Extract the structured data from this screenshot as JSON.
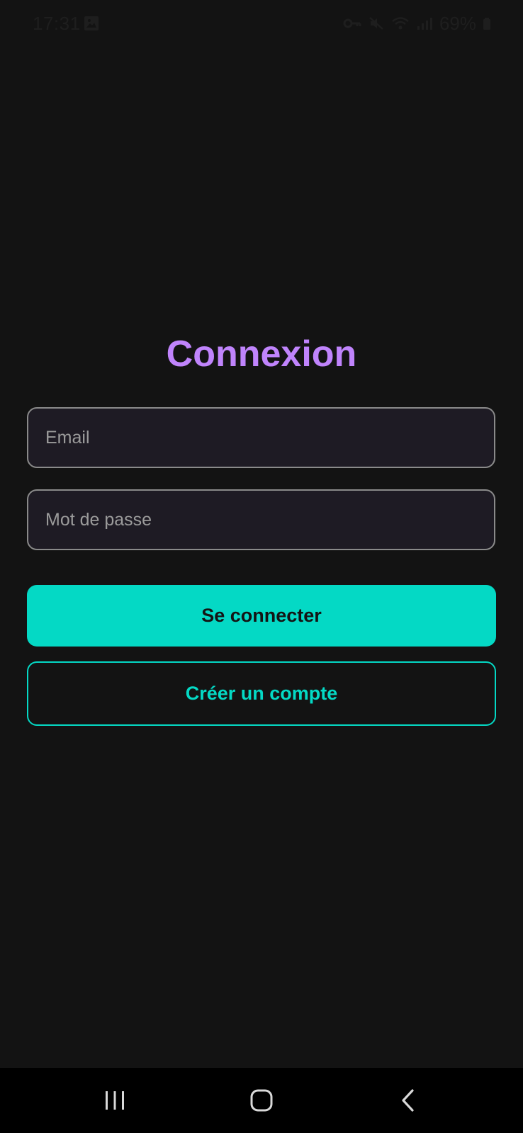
{
  "status_bar": {
    "time": "17:31",
    "battery_text": "69%",
    "icons": [
      "gallery-icon",
      "vpn-key-icon",
      "mute-icon",
      "wifi-icon",
      "signal-icon",
      "battery-icon"
    ]
  },
  "login": {
    "title": "Connexion",
    "email": {
      "value": "",
      "placeholder": "Email"
    },
    "password": {
      "value": "",
      "placeholder": "Mot de passe"
    },
    "login_button_label": "Se connecter",
    "register_button_label": "Créer un compte"
  },
  "nav_bar": {
    "icons": [
      "recents-icon",
      "home-icon",
      "back-icon"
    ]
  },
  "colors": {
    "background": "#131313",
    "title": "#c084fc",
    "accent": "#04d9c5",
    "field_background": "#1e1b24",
    "field_border": "#8a8a8a"
  }
}
